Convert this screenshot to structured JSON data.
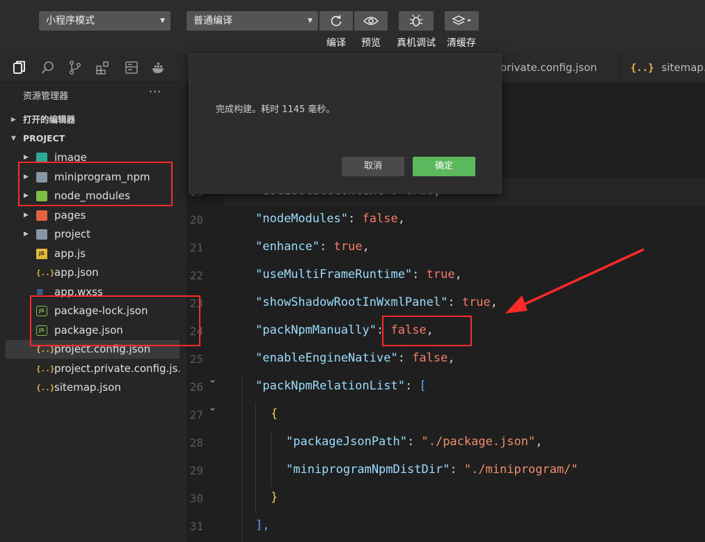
{
  "toolbar": {
    "mode_select": "小程序模式",
    "compile_select": "普通编译",
    "buttons": [
      {
        "icon": "refresh-icon",
        "label": "编译"
      },
      {
        "icon": "eye-icon",
        "label": "预览"
      },
      {
        "icon": "bug-icon",
        "label": "真机调试"
      },
      {
        "icon": "layers-icon",
        "label": "清缓存"
      }
    ]
  },
  "sidebar": {
    "title": "资源管理器",
    "more": "···",
    "open_editors": "打开的编辑器",
    "project": "PROJECT",
    "items": [
      {
        "name": "image",
        "type": "folder"
      },
      {
        "name": "miniprogram_npm",
        "type": "folder"
      },
      {
        "name": "node_modules",
        "type": "folder"
      },
      {
        "name": "pages",
        "type": "folder"
      },
      {
        "name": "project",
        "type": "folder"
      },
      {
        "name": "app.js",
        "type": "js"
      },
      {
        "name": "app.json",
        "type": "json"
      },
      {
        "name": "app.wxss",
        "type": "css"
      },
      {
        "name": "package-lock.json",
        "type": "node"
      },
      {
        "name": "package.json",
        "type": "node"
      },
      {
        "name": "project.config.json",
        "type": "json"
      },
      {
        "name": "project.private.config.js...",
        "type": "json"
      },
      {
        "name": "sitemap.json",
        "type": "json"
      }
    ]
  },
  "tabs": [
    "t.private.config.json",
    "sitemap.jso"
  ],
  "tab_icon": "{..}",
  "editor": {
    "lines": [
      {
        "num": "19",
        "key": "\"useIsolateContext\"",
        "value": "true"
      },
      {
        "num": "20",
        "key": "\"nodeModules\"",
        "value": "false"
      },
      {
        "num": "21",
        "key": "\"enhance\"",
        "value": "true"
      },
      {
        "num": "22",
        "key": "\"useMultiFrameRuntime\"",
        "value": "true"
      },
      {
        "num": "23",
        "key": "\"showShadowRootInWxmlPanel\"",
        "value": "true"
      },
      {
        "num": "24",
        "key": "\"packNpmManually\"",
        "value": "false"
      },
      {
        "num": "25",
        "key": "\"enableEngineNative\"",
        "value": "false"
      },
      {
        "num": "26",
        "key": "\"packNpmRelationList\"",
        "value": "["
      },
      {
        "num": "27",
        "key": "",
        "value": "{"
      },
      {
        "num": "28",
        "key": "\"packageJsonPath\"",
        "value": "\"./package.json\""
      },
      {
        "num": "29",
        "key": "\"miniprogramNpmDistDir\"",
        "value": "\"./miniprogram/\""
      },
      {
        "num": "30",
        "key": "",
        "value": "}"
      },
      {
        "num": "31",
        "key": "",
        "value": "],"
      }
    ]
  },
  "dialog": {
    "message": "完成构建。耗时 1145 毫秒。",
    "cancel": "取消",
    "confirm": "确定"
  },
  "colors": {
    "accent_green": "#5cb85c",
    "annotation_red": "#ff2a2a"
  }
}
